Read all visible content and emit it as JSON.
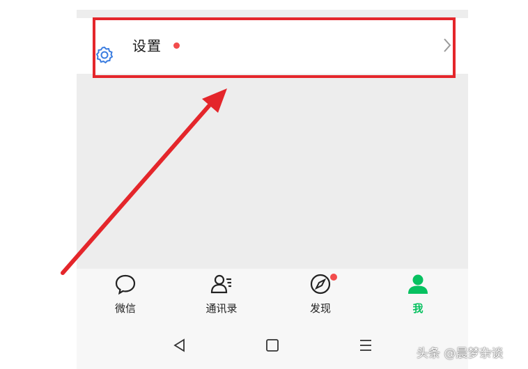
{
  "settings": {
    "label": "设置",
    "has_red_dot": true
  },
  "tabbar": {
    "tabs": [
      {
        "label": "微信",
        "icon": "chat-bubble-icon",
        "active": false
      },
      {
        "label": "通讯录",
        "icon": "contacts-icon",
        "active": false
      },
      {
        "label": "发现",
        "icon": "compass-icon",
        "active": false,
        "badge_dot": true
      },
      {
        "label": "我",
        "icon": "person-icon",
        "active": true
      }
    ]
  },
  "system_nav": {
    "buttons": [
      "back-triangle-icon",
      "home-square-icon",
      "menu-lines-icon"
    ]
  },
  "watermark": {
    "text": "头条 @晨梦杂谈"
  },
  "colors": {
    "accent_green": "#07c160",
    "badge_red": "#f24c4c",
    "highlight_red": "#e4262b",
    "background": "#ededed"
  }
}
